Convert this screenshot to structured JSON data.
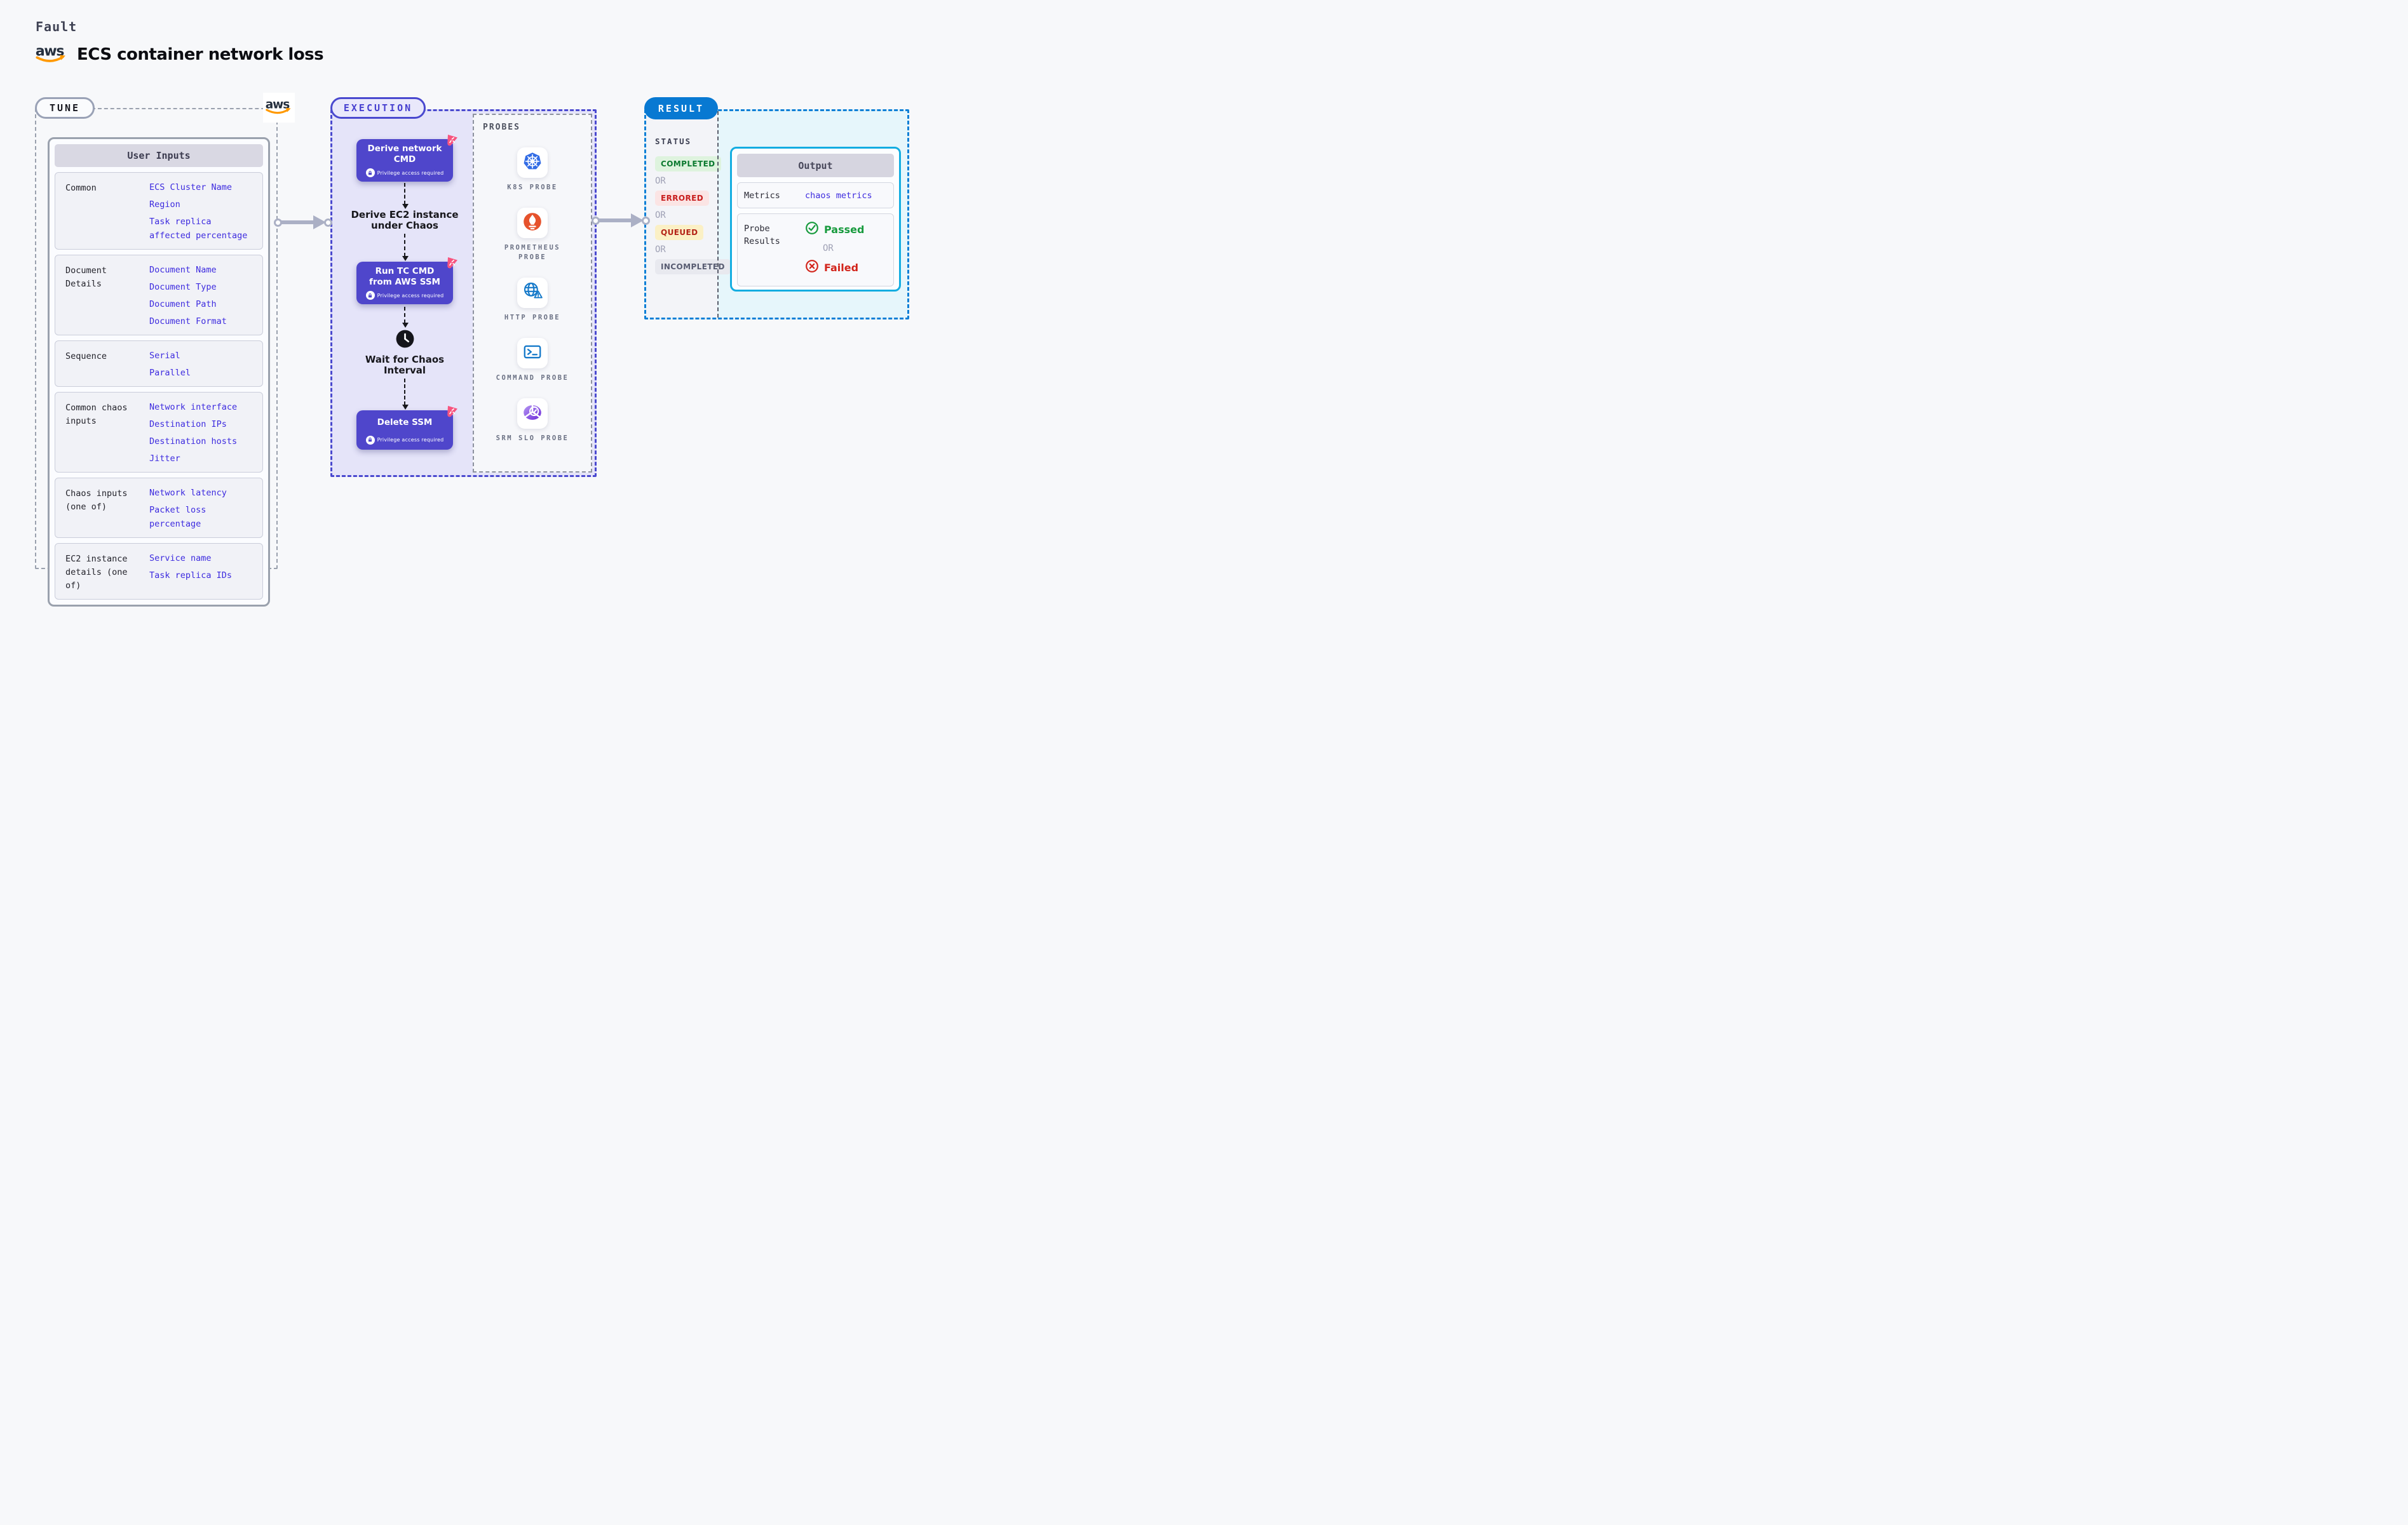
{
  "page": {
    "fault_label": "Fault",
    "title": "ECS container network loss"
  },
  "tune": {
    "badge": "TUNE",
    "table": {
      "header": "User Inputs",
      "rows": [
        {
          "label": "Common",
          "values": [
            "ECS Cluster Name",
            "Region",
            "Task replica affected percentage"
          ]
        },
        {
          "label": "Document Details",
          "values": [
            "Document Name",
            "Document Type",
            "Document Path",
            "Document Format"
          ]
        },
        {
          "label": "Sequence",
          "values": [
            "Serial",
            "Parallel"
          ]
        },
        {
          "label": "Common chaos inputs",
          "values": [
            "Network interface",
            "Destination IPs",
            "Destination hosts",
            "Jitter"
          ]
        },
        {
          "label": "Chaos inputs (one of)",
          "values": [
            "Network latency",
            "Packet loss percentage"
          ]
        },
        {
          "label": "EC2 instance details (one of)",
          "values": [
            "Service name",
            "Task replica IDs"
          ]
        }
      ]
    }
  },
  "execution": {
    "badge": "EXECUTION",
    "steps": [
      {
        "label": "Derive network CMD",
        "note": "Privilege access required"
      },
      {
        "label": "Derive EC2 instance under Chaos"
      },
      {
        "label": "Run TC CMD from AWS SSM",
        "note": "Privilege access required"
      },
      {
        "label": "Wait for Chaos Interval"
      },
      {
        "label": "Delete SSM",
        "note": "Privilege access required"
      }
    ],
    "probes": {
      "label": "PROBES",
      "items": [
        {
          "label": "K8S PROBE",
          "icon": "kubernetes-icon"
        },
        {
          "label": "PROMETHEUS PROBE",
          "icon": "prometheus-icon"
        },
        {
          "label": "HTTP PROBE",
          "icon": "http-globe-warning-icon"
        },
        {
          "label": "COMMAND PROBE",
          "icon": "terminal-icon"
        },
        {
          "label": "SRM SLO PROBE",
          "icon": "slo-donut-check-icon"
        }
      ]
    }
  },
  "result": {
    "badge": "RESULT",
    "status": {
      "label": "STATUS",
      "separator": "OR",
      "values": [
        "COMPLETED",
        "ERRORED",
        "QUEUED",
        "INCOMPLETED"
      ]
    },
    "output": {
      "header": "Output",
      "metrics_label": "Metrics",
      "metrics_value": "chaos metrics",
      "probe_label": "Probe Results",
      "passed": "Passed",
      "or": "OR",
      "failed": "Failed"
    }
  },
  "colors": {
    "page_bg": "#f7f8fa",
    "title_ink": "#0c0d12",
    "mono_ink": "#3f4254",
    "label_ink": "#23232b",
    "value_blue": "#3d2bdf",
    "tune_border": "#9aa1ae",
    "table_border": "#9aa1ad",
    "table_header_bg": "#d9d8e3",
    "table_header_ink": "#3c3c50",
    "row_bg": "#f1f2f7",
    "row_border": "#cacdda",
    "arrow_gray": "#abb0c5",
    "indigo": "#4a49cf",
    "indigo_ink": "#4740d0",
    "node_bg": "#4f46cb",
    "lavender": "#e5e4f9",
    "badge_lavender_bg": "#e9e8fb",
    "chaos_pink": "#f7547f",
    "flow_ink": "#17171c",
    "probes_border": "#8d929f",
    "probes_bg": "#f6f7fa",
    "probe_label_ink": "#6b7184",
    "k8s_blue": "#326ce5",
    "prometheus_orange": "#e6522c",
    "http_blue": "#1579c9",
    "srm_purple_light": "#b497f2",
    "srm_purple_dark": "#6d28d9",
    "result_blue": "#0879d2",
    "result_border": "#0d7fd6",
    "status_col_bg": "#f3f4f8",
    "result_tint": "#e6f6fb",
    "sep_gray": "#5a5e6c",
    "status_ink": "#3c3f52",
    "completed_bg": "#def3de",
    "completed_ink": "#0c7a30",
    "errored_bg": "#fbe4e4",
    "errored_ink": "#c81e1e",
    "queued_bg": "#fbf0c5",
    "queued_ink": "#b42318",
    "incompleted_bg": "#e8e9ef",
    "incompleted_ink": "#585c72",
    "or_ink": "#9fa1b5",
    "cyan": "#13ade1",
    "output_header_bg": "#d6d5e0",
    "output_header_ink": "#47475a",
    "output_row_bg": "#f8f9fc",
    "output_row_border": "#d3d6e0",
    "passed_green": "#179a3d",
    "failed_red": "#d2251c",
    "aws_navy": "#252f3e",
    "aws_orange": "#ff9900",
    "black_icon": "#15151b"
  }
}
